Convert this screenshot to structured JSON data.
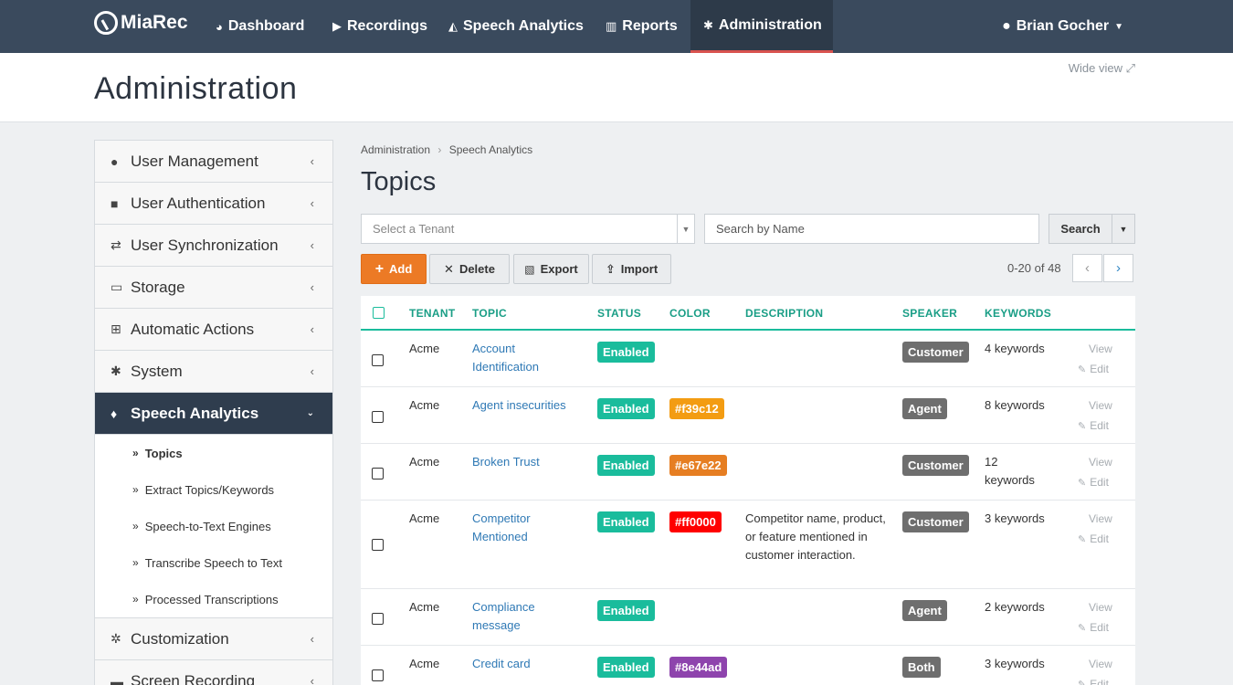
{
  "nav": {
    "brand": "MiaRec",
    "items": [
      {
        "icon": "dashboard-icon",
        "glyph": "◕",
        "label": "Dashboard"
      },
      {
        "icon": "recordings-icon",
        "glyph": "▶",
        "label": "Recordings"
      },
      {
        "icon": "speech-analytics-icon",
        "glyph": "◭",
        "label": "Speech Analytics"
      },
      {
        "icon": "reports-icon",
        "glyph": "▥",
        "label": "Reports"
      },
      {
        "icon": "gear-icon",
        "glyph": "✱",
        "label": "Administration"
      }
    ],
    "user": "Brian Gocher"
  },
  "header": {
    "title": "Administration",
    "wide_view": "Wide view"
  },
  "sidebar": {
    "items": [
      {
        "label": "User Management",
        "glyph": "●"
      },
      {
        "label": "User Authentication",
        "glyph": "■"
      },
      {
        "label": "User Synchronization",
        "glyph": "⇄"
      },
      {
        "label": "Storage",
        "glyph": "▭"
      },
      {
        "label": "Automatic Actions",
        "glyph": "⊞"
      },
      {
        "label": "System",
        "glyph": "✱"
      },
      {
        "label": "Speech Analytics",
        "glyph": "♦"
      }
    ],
    "subitems": [
      "Topics",
      "Extract Topics/Keywords",
      "Speech-to-Text Engines",
      "Transcribe Speech to Text",
      "Processed Transcriptions"
    ],
    "after": [
      {
        "label": "Customization",
        "glyph": "✲"
      },
      {
        "label": "Screen Recording",
        "glyph": "▬"
      }
    ]
  },
  "breadcrumb": [
    "Administration",
    "Speech Analytics"
  ],
  "page_title": "Topics",
  "filters": {
    "tenant_placeholder": "Select a Tenant",
    "search_placeholder": "Search by Name",
    "search_label": "Search"
  },
  "toolbar": {
    "add": "Add",
    "delete": "Delete",
    "export": "Export",
    "import": "Import",
    "range": "0-20 of 48"
  },
  "table": {
    "headers": [
      "TENANT",
      "TOPIC",
      "STATUS",
      "COLOR",
      "DESCRIPTION",
      "SPEAKER",
      "KEYWORDS"
    ],
    "view_label": "View",
    "edit_label": "Edit",
    "rows": [
      {
        "tenant": "Acme",
        "topic": "Account Identification",
        "status": "Enabled",
        "color": "",
        "description": "",
        "speaker": "Customer",
        "keywords": "4 keywords"
      },
      {
        "tenant": "Acme",
        "topic": "Agent insecurities",
        "status": "Enabled",
        "color": "#f39c12",
        "description": "",
        "speaker": "Agent",
        "keywords": "8 keywords"
      },
      {
        "tenant": "Acme",
        "topic": "Broken Trust",
        "status": "Enabled",
        "color": "#e67e22",
        "description": "",
        "speaker": "Customer",
        "keywords": "12 keywords"
      },
      {
        "tenant": "Acme",
        "topic": "Competitor Mentioned",
        "status": "Enabled",
        "color": "#ff0000",
        "description": "Competitor name, product, or feature mentioned in customer interaction.",
        "speaker": "Customer",
        "keywords": "3 keywords"
      },
      {
        "tenant": "Acme",
        "topic": "Compliance message",
        "status": "Enabled",
        "color": "",
        "description": "",
        "speaker": "Agent",
        "keywords": "2 keywords"
      },
      {
        "tenant": "Acme",
        "topic": "Credit card",
        "status": "Enabled",
        "color": "#8e44ad",
        "description": "",
        "speaker": "Both",
        "keywords": "3 keywords"
      }
    ]
  }
}
